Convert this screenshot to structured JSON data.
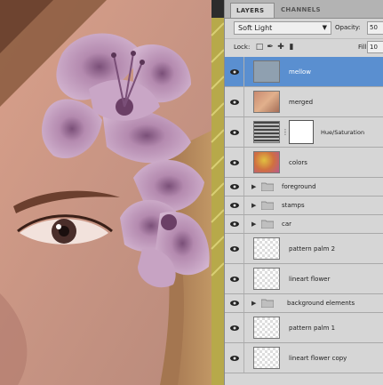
{
  "panel": {
    "tabs": {
      "layers": "LAYERS",
      "channels": "CHANNELS"
    },
    "blend_mode": "Soft Light",
    "opacity_label": "Opacity:",
    "opacity_value": "50",
    "lock_label": "Lock:",
    "fill_label": "Fill:",
    "fill_value": "10"
  },
  "layers": [
    {
      "name": "mellow",
      "kind": "pixel",
      "selected": true
    },
    {
      "name": "merged",
      "kind": "pixel"
    },
    {
      "name": "Hue/Saturation",
      "kind": "adjustment"
    },
    {
      "name": "colors",
      "kind": "pixel"
    },
    {
      "name": "foreground",
      "kind": "group"
    },
    {
      "name": "stamps",
      "kind": "group"
    },
    {
      "name": "car",
      "kind": "group"
    },
    {
      "name": "pattern palm 2",
      "kind": "pixel"
    },
    {
      "name": "lineart flower",
      "kind": "pixel"
    },
    {
      "name": "background elements",
      "kind": "group"
    },
    {
      "name": "pattern palm 1",
      "kind": "pixel"
    },
    {
      "name": "lineart flower copy",
      "kind": "pixel"
    }
  ],
  "colors": {
    "selection": "#5a8fd0",
    "panel_bg": "#d6d6d6",
    "flower": "#b88fb2"
  },
  "icons": [
    "eye-icon",
    "chevron-down-icon",
    "folder-icon",
    "chain-icon",
    "lock-transparent-icon",
    "brush-icon",
    "move-icon",
    "lock-icon"
  ]
}
